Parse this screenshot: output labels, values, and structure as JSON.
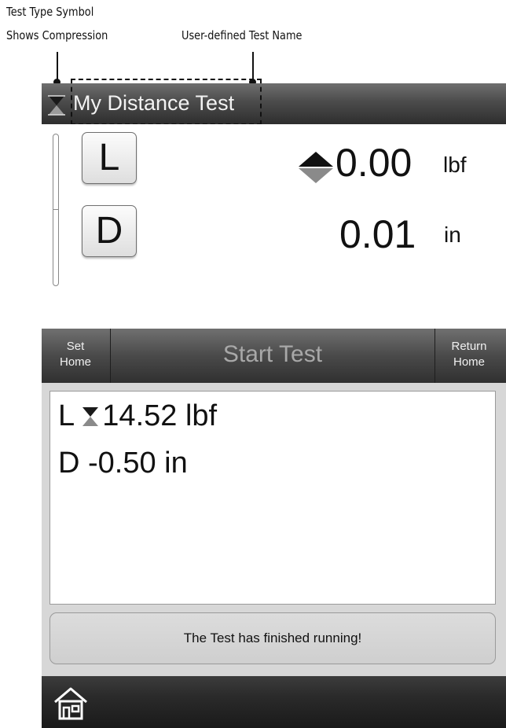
{
  "annotations": {
    "symbol_callout_line1": "Test Type Symbol",
    "symbol_callout_line2": "Shows Compression",
    "name_callout": "User-defined Test Name"
  },
  "titlebar": {
    "test_name": "My Distance Test",
    "test_type_icon": "compression-hourglass-icon"
  },
  "readings": {
    "load_key": "L",
    "load_value": "0.00",
    "load_unit": "lbf",
    "load_direction_icon": "direction-arrows-icon",
    "distance_key": "D",
    "distance_value": "0.01",
    "distance_unit": "in"
  },
  "actions": {
    "set_home_line1": "Set",
    "set_home_line2": "Home",
    "start_test": "Start Test",
    "return_home_line1": "Return",
    "return_home_line2": "Home"
  },
  "results": {
    "load_line_prefix": "L",
    "load_line_value": "14.52 lbf",
    "distance_line": "D -0.50 in"
  },
  "status_message": "The Test has finished running!",
  "bottombar": {
    "home_icon": "home-icon"
  },
  "colors": {
    "bar_dark": "#2e2e2e",
    "panel_gray": "#d7d7d7",
    "arrow_gray": "#8a8a8a"
  }
}
